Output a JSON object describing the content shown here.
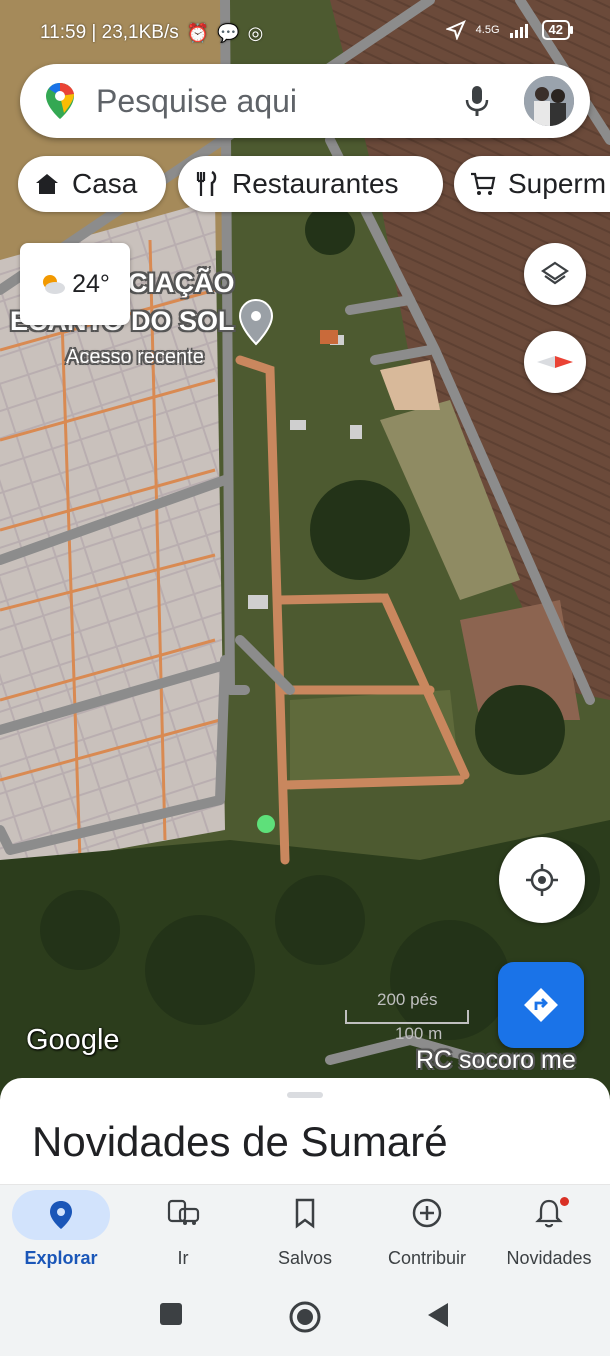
{
  "status": {
    "time_speed": "11:59 | 23,1KB/s",
    "network": "4.5G",
    "battery": "42"
  },
  "search": {
    "placeholder": "Pesquise aqui",
    "icons": [
      "maps-pin-logo",
      "mic-icon",
      "avatar"
    ]
  },
  "chips": [
    {
      "label": "Casa",
      "icon": "home-icon"
    },
    {
      "label": "Restaurantes",
      "icon": "restaurant-icon"
    },
    {
      "label": "Superm",
      "icon": "cart-icon"
    }
  ],
  "weather": {
    "temp": "24°",
    "icon": "partly-cloudy-icon"
  },
  "map_labels": {
    "place_line1": "CIAÇÃO",
    "place_line2": "ECANTO DO SOL",
    "place_sub": "Acesso recente",
    "road": "RC socoro me",
    "google": "Google",
    "scale_ft": "200 pés",
    "scale_m": "100 m"
  },
  "sheet": {
    "title": "Novidades de Sumaré"
  },
  "nav": [
    {
      "label": "Explorar",
      "icon": "explore-pin-icon",
      "active": true
    },
    {
      "label": "Ir",
      "icon": "commute-icon"
    },
    {
      "label": "Salvos",
      "icon": "bookmark-icon"
    },
    {
      "label": "Contribuir",
      "icon": "add-circle-icon"
    },
    {
      "label": "Novidades",
      "icon": "bell-icon"
    }
  ],
  "colors": {
    "accent": "#1a73e8",
    "nav_active_bg": "#d2e3fc",
    "notif": "#d93025"
  }
}
